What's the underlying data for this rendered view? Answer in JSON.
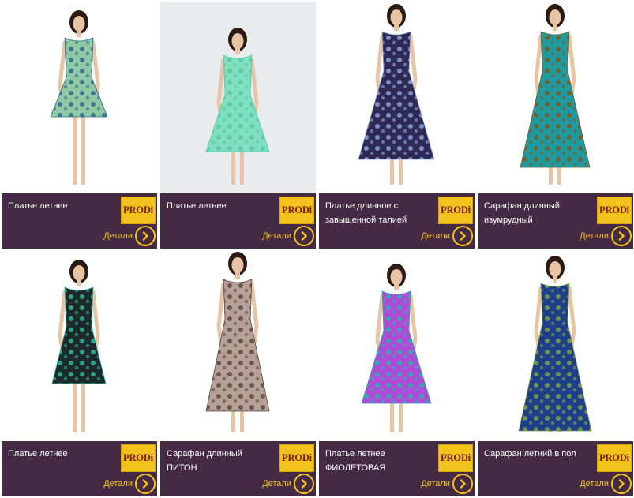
{
  "colors": {
    "panel": "#452a44",
    "accent": "#f1c21b",
    "brand_text": "#7b1d12"
  },
  "products": [
    {
      "name": "Платье летнее",
      "brand": "PRODi",
      "details_label": "Детали",
      "dress_colors": [
        "#8fc9a3",
        "#2e6a8c"
      ],
      "background": "#ffffff"
    },
    {
      "name": "Платье летнее",
      "brand": "PRODi",
      "details_label": "Детали",
      "dress_colors": [
        "#7fe0c0",
        "#5cc7a5"
      ],
      "background": "#e9ecec"
    },
    {
      "name": "Платье длинное с завышенной талией",
      "brand": "PRODi",
      "details_label": "Детали",
      "dress_colors": [
        "#2e2a55",
        "#8aa3d6"
      ],
      "background": "#ffffff"
    },
    {
      "name": "Сарафан длинный изумрудный",
      "brand": "PRODi",
      "details_label": "Детали",
      "dress_colors": [
        "#1e9aa0",
        "#7a5a1e"
      ],
      "background": "#ffffff"
    },
    {
      "name": "Платье летнее",
      "brand": "PRODi",
      "details_label": "Детали",
      "dress_colors": [
        "#1e2a2a",
        "#2fb8a0"
      ],
      "background": "#ffffff"
    },
    {
      "name": "Сарафан длинный ПИТОН",
      "brand": "PRODi",
      "details_label": "Детали",
      "dress_colors": [
        "#b7a095",
        "#5a4a48"
      ],
      "background": "#ffffff"
    },
    {
      "name": "Платье летнее ФИОЛЕТОВАЯ",
      "brand": "PRODi",
      "details_label": "Детали",
      "dress_colors": [
        "#b04ad8",
        "#1eb8a8"
      ],
      "background": "#ffffff"
    },
    {
      "name": "Сарафан летний в пол",
      "brand": "PRODi",
      "details_label": "Детали",
      "dress_colors": [
        "#1e3f8a",
        "#7ea04a"
      ],
      "background": "#ffffff"
    }
  ]
}
